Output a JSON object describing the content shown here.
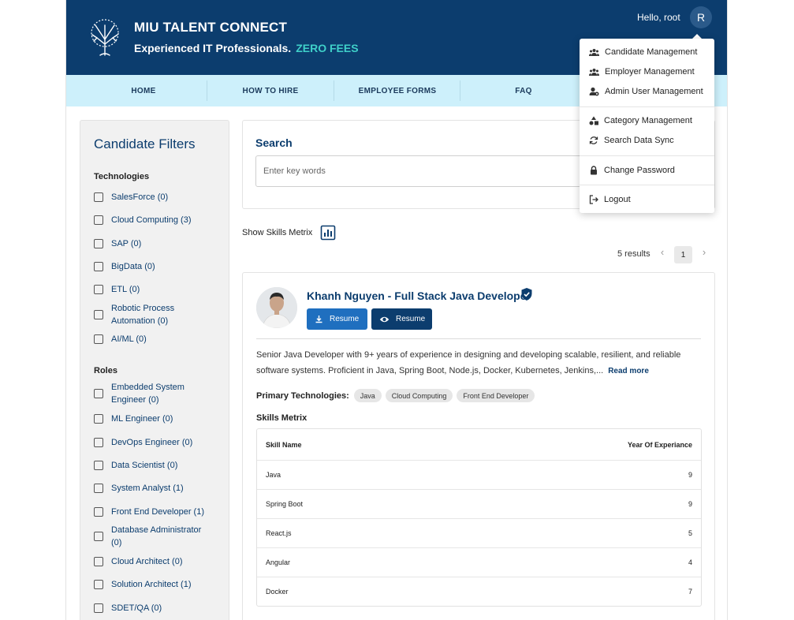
{
  "header": {
    "brand_title": "MIU TALENT CONNECT",
    "tagline": "Experienced IT Professionals.",
    "tagline_accent": "ZERO FEES",
    "greeting": "Hello, root",
    "avatar_initial": "R",
    "colors": {
      "header_bg": "#0c3d6e",
      "accent": "#3fd0c9",
      "nav_bg": "#cdf0fb"
    }
  },
  "nav": {
    "items": [
      "HOME",
      "HOW TO HIRE",
      "EMPLOYEE FORMS",
      "FAQ"
    ]
  },
  "user_menu": {
    "items": [
      {
        "label": "Candidate Management",
        "icon": "people-icon"
      },
      {
        "label": "Employer Management",
        "icon": "people-icon"
      },
      {
        "label": "Admin User Management",
        "icon": "admin-icon"
      },
      {
        "label": "Category Management",
        "icon": "category-icon"
      },
      {
        "label": "Search Data Sync",
        "icon": "sync-icon"
      },
      {
        "label": "Change Password",
        "icon": "lock-icon"
      },
      {
        "label": "Logout",
        "icon": "logout-icon"
      }
    ]
  },
  "filters": {
    "title": "Candidate Filters",
    "technologies_title": "Technologies",
    "technologies": [
      "SalesForce (0)",
      "Cloud Computing (3)",
      "SAP (0)",
      "BigData (0)",
      "ETL (0)",
      "Robotic Process Automation (0)",
      "AI/ML (0)"
    ],
    "roles_title": "Roles",
    "roles": [
      "Embedded System Engineer (0)",
      "ML Engineer (0)",
      "DevOps Engineer (0)",
      "Data Scientist (0)",
      "System Analyst (1)",
      "Front End Developer (1)",
      "Database Administrator (0)",
      "Cloud Architect (0)",
      "Solution Architect (1)",
      "SDET/QA (0)"
    ]
  },
  "search": {
    "title": "Search",
    "placeholder": "Enter key words"
  },
  "skills_toggle_label": "Show Skills Metrix",
  "results": {
    "count_label": "5 results",
    "current_page": "1"
  },
  "candidate": {
    "name": "Khanh Nguyen - Full Stack Java Developer",
    "download_label": "Resume",
    "view_label": "Resume",
    "summary": "Senior Java Developer with 9+ years of experience in designing and developing scalable, resilient, and reliable software systems. Proficient in Java, Spring Boot, Node.js, Docker, Kubernetes, Jenkins,...",
    "read_more": "Read more",
    "primary_tech_label": "Primary Technologies:",
    "primary_tech": [
      "Java",
      "Cloud Computing",
      "Front End Developer"
    ],
    "skills_title": "Skills Metrix",
    "skills_header": {
      "name": "Skill Name",
      "years": "Year Of Experiance"
    },
    "skills": [
      {
        "name": "Java",
        "years": "9"
      },
      {
        "name": "Spring Boot",
        "years": "9"
      },
      {
        "name": "React.js",
        "years": "5"
      },
      {
        "name": "Angular",
        "years": "4"
      },
      {
        "name": "Docker",
        "years": "7"
      }
    ]
  }
}
